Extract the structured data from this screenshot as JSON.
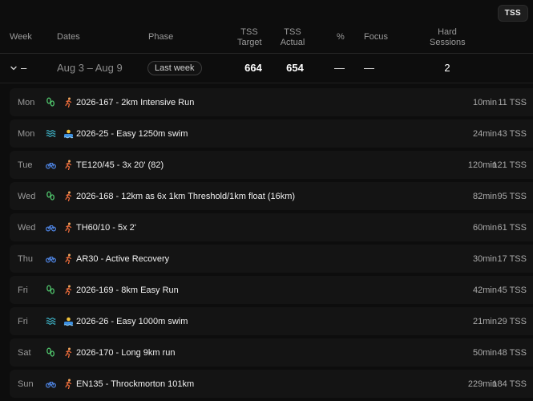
{
  "toggle_label": "TSS",
  "header": {
    "week": "Week",
    "dates": "Dates",
    "phase": "Phase",
    "tss_target_1": "TSS",
    "tss_target_2": "Target",
    "tss_actual_1": "TSS",
    "tss_actual_2": "Actual",
    "percent": "%",
    "focus": "Focus",
    "hard_1": "Hard",
    "hard_2": "Sessions"
  },
  "week": {
    "label": "–",
    "dates": "Aug 3 – Aug 9",
    "phase_badge": "Last week",
    "tss_target": "664",
    "tss_actual": "654",
    "percent": "—",
    "focus": "—",
    "hard_sessions": "2"
  },
  "sessions": [
    {
      "day": "Mon",
      "sport": "run",
      "name": "2026-167 - 2km Intensive Run",
      "duration": "10min",
      "tss": "11 TSS"
    },
    {
      "day": "Mon",
      "sport": "swim",
      "name": "2026-25 - Easy 1250m swim",
      "duration": "24min",
      "tss": "43 TSS"
    },
    {
      "day": "Tue",
      "sport": "bike",
      "name": "TE120/45 - 3x 20' (82)",
      "duration": "120min",
      "tss": "121 TSS"
    },
    {
      "day": "Wed",
      "sport": "run",
      "name": "2026-168 - 12km as 6x 1km Threshold/1km float (16km)",
      "duration": "82min",
      "tss": "95 TSS"
    },
    {
      "day": "Wed",
      "sport": "bike",
      "name": "TH60/10 - 5x 2'",
      "duration": "60min",
      "tss": "61 TSS"
    },
    {
      "day": "Thu",
      "sport": "bike",
      "name": "AR30 - Active Recovery",
      "duration": "30min",
      "tss": "17 TSS"
    },
    {
      "day": "Fri",
      "sport": "run",
      "name": "2026-169 - 8km Easy Run",
      "duration": "42min",
      "tss": "45 TSS"
    },
    {
      "day": "Fri",
      "sport": "swim",
      "name": "2026-26 - Easy 1000m swim",
      "duration": "21min",
      "tss": "29 TSS"
    },
    {
      "day": "Sat",
      "sport": "run",
      "name": "2026-170 - Long 9km run",
      "duration": "50min",
      "tss": "48 TSS"
    },
    {
      "day": "Sun",
      "sport": "bike",
      "name": "EN135 - Throckmorton 101km",
      "duration": "229min",
      "tss": "184 TSS"
    }
  ],
  "colors": {
    "run": "#4fc36b",
    "swim": "#3fb5c9",
    "bike": "#4f86e6"
  }
}
